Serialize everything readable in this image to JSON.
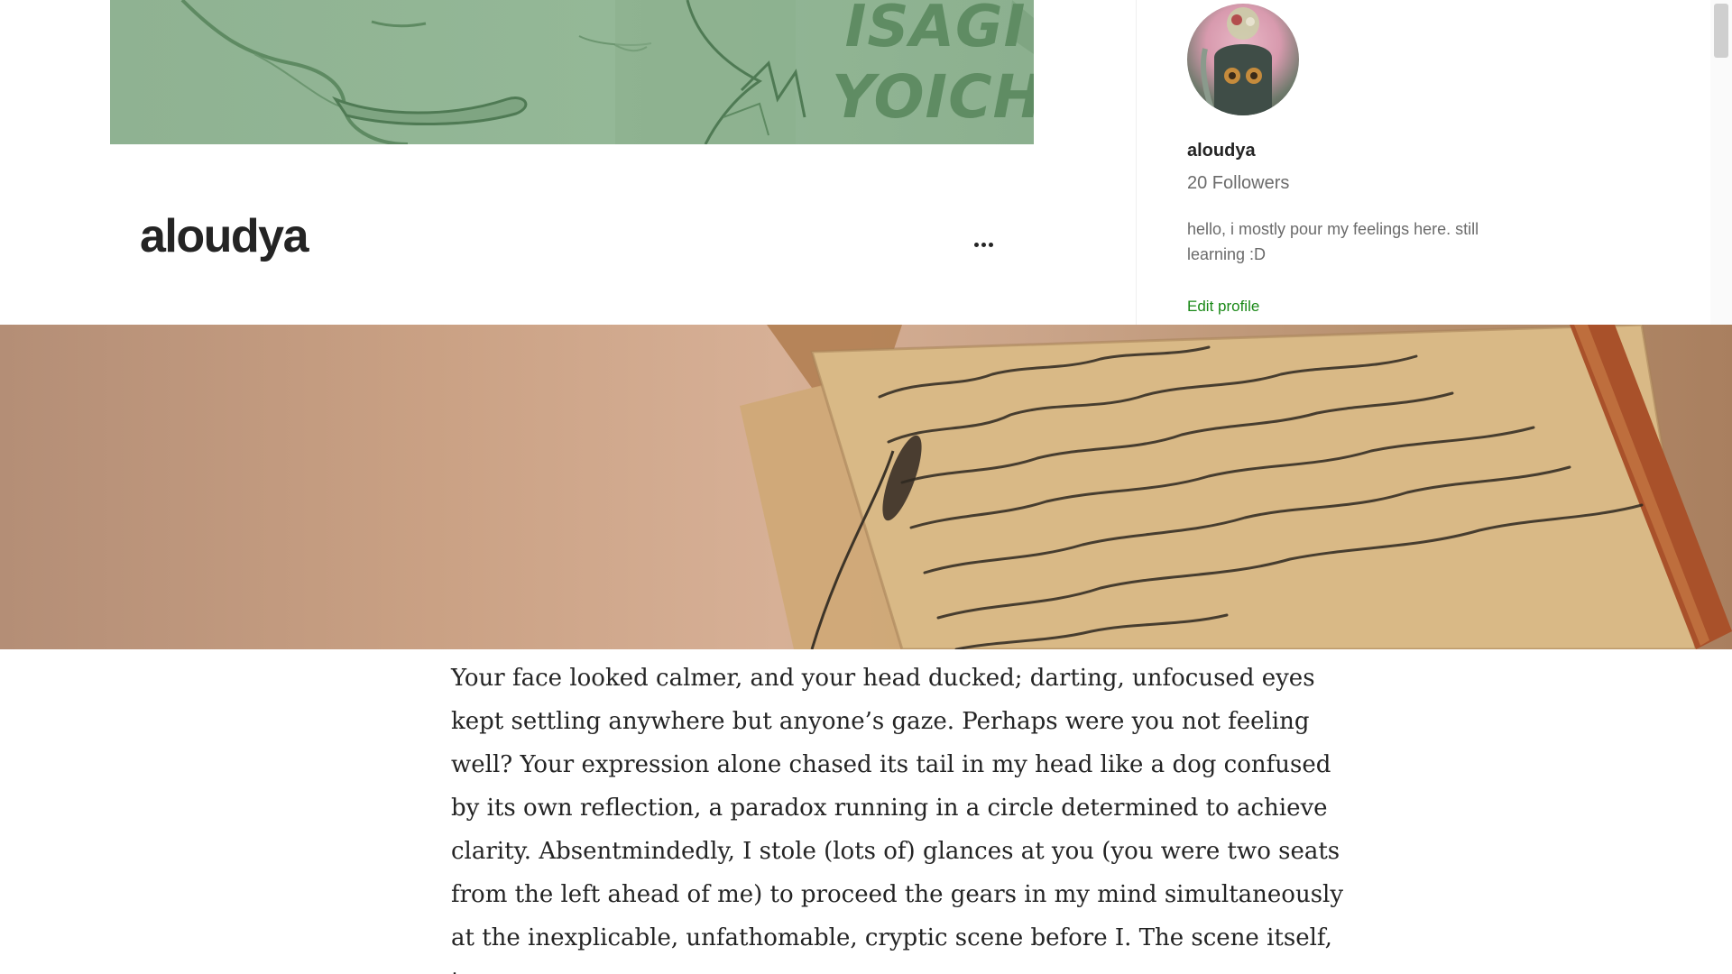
{
  "banner": {
    "text_line1": "ISAGI",
    "text_line2": "YOICHI."
  },
  "profile": {
    "title": "aloudya"
  },
  "sidebar": {
    "name": "aloudya",
    "followers": "20 Followers",
    "bio": "hello, i mostly pour my feelings here. still learning :D",
    "edit_profile": "Edit profile"
  },
  "article": {
    "body": "Your face looked calmer, and your head ducked; darting, unfocused eyes kept settling anywhere but anyone’s gaze. Perhaps were you not feeling well? Your expression alone chased its tail in my head like a dog confused by its own reflection, a paradox running in a circle determined to achieve clarity. Absentmindedly, I stole (lots of) glances at you (you were two seats from the left ahead of me) to proceed the gears in my mind simultaneously at the inexplicable, unfathomable, cryptic scene before I. The scene itself, too,"
  },
  "colors": {
    "accent_green": "#1a8917",
    "banner_green": "#94b897",
    "text": "#242424",
    "muted": "#6b6b6b"
  }
}
